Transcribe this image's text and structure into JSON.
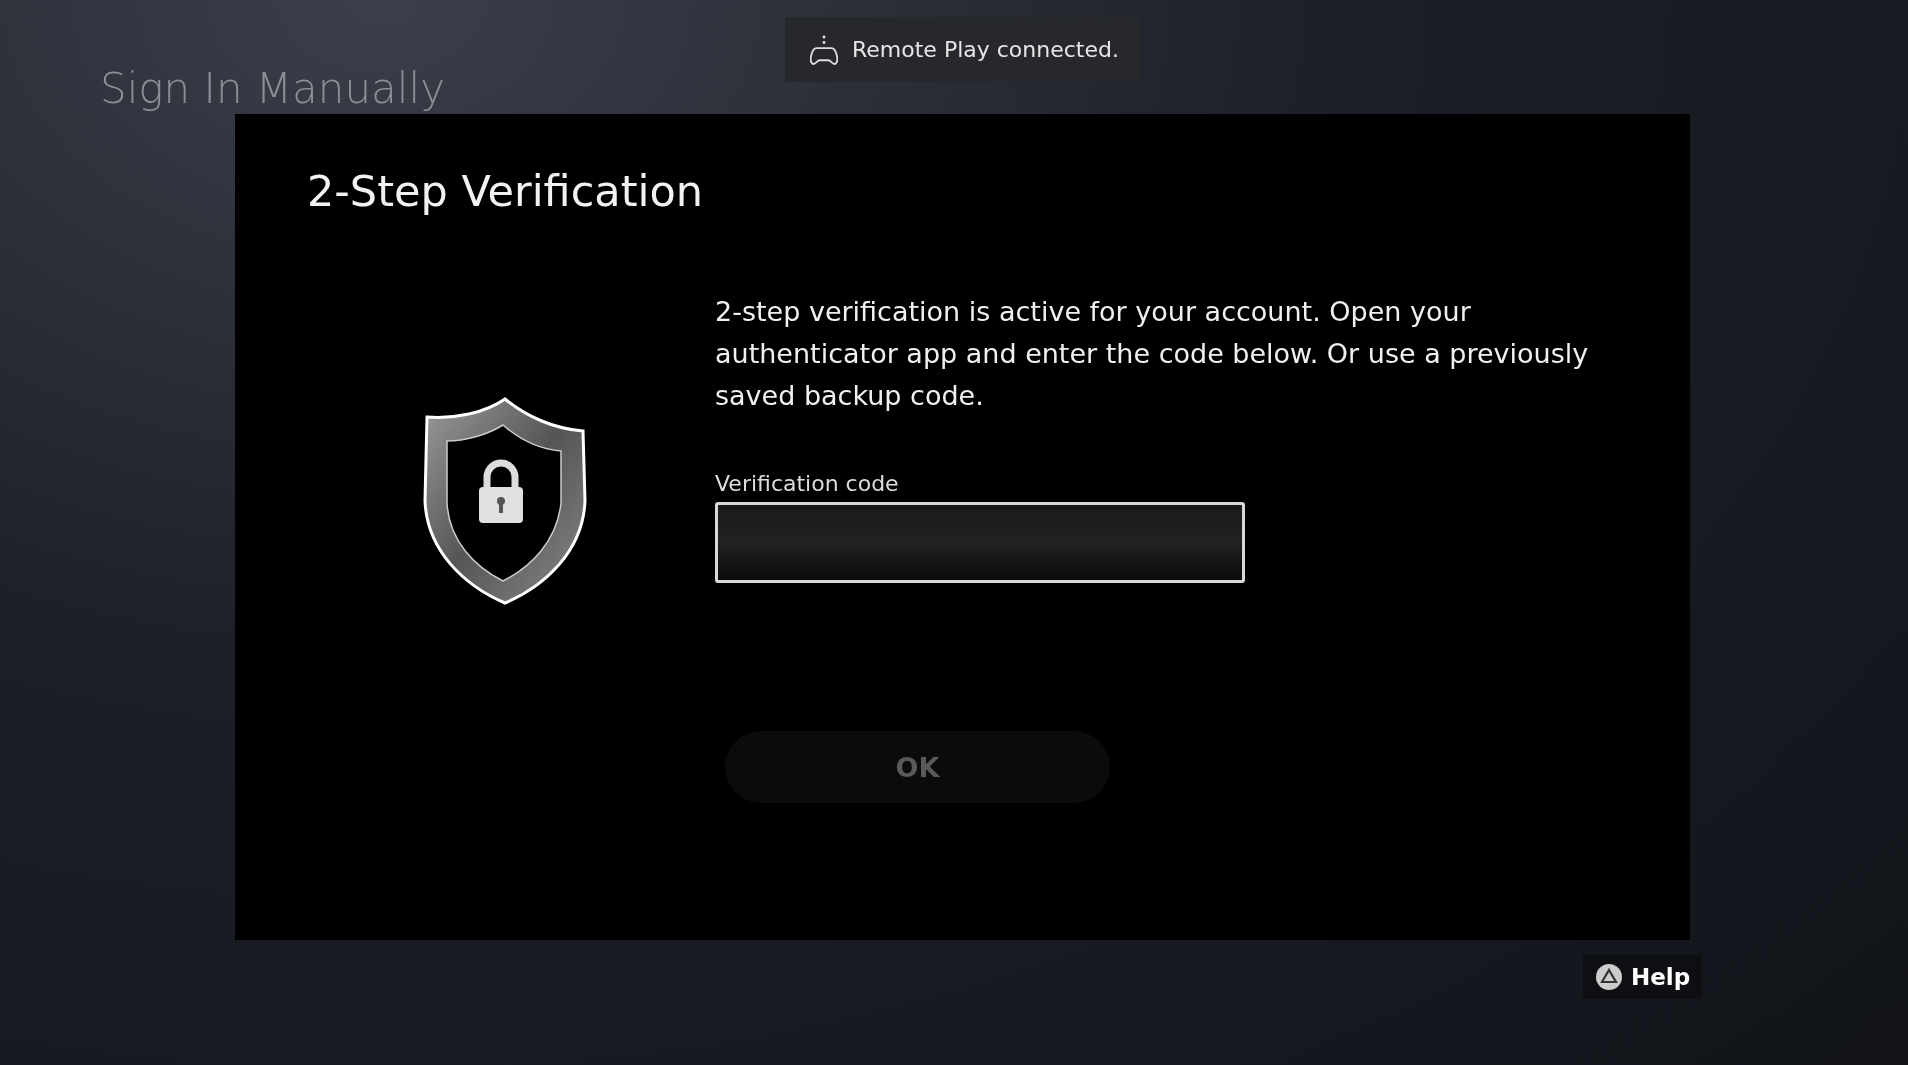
{
  "page": {
    "title": "Sign In Manually"
  },
  "toast": {
    "text": "Remote Play connected."
  },
  "dialog": {
    "title": "2-Step Verification",
    "message": "2-step verification is active for your account. Open your authenticator app and enter the code below. Or use a previously saved backup code.",
    "field": {
      "label": "Verification code"
    },
    "ok_button": {
      "label": "OK",
      "disabled": true
    }
  },
  "help_button": {
    "label": "Help"
  }
}
